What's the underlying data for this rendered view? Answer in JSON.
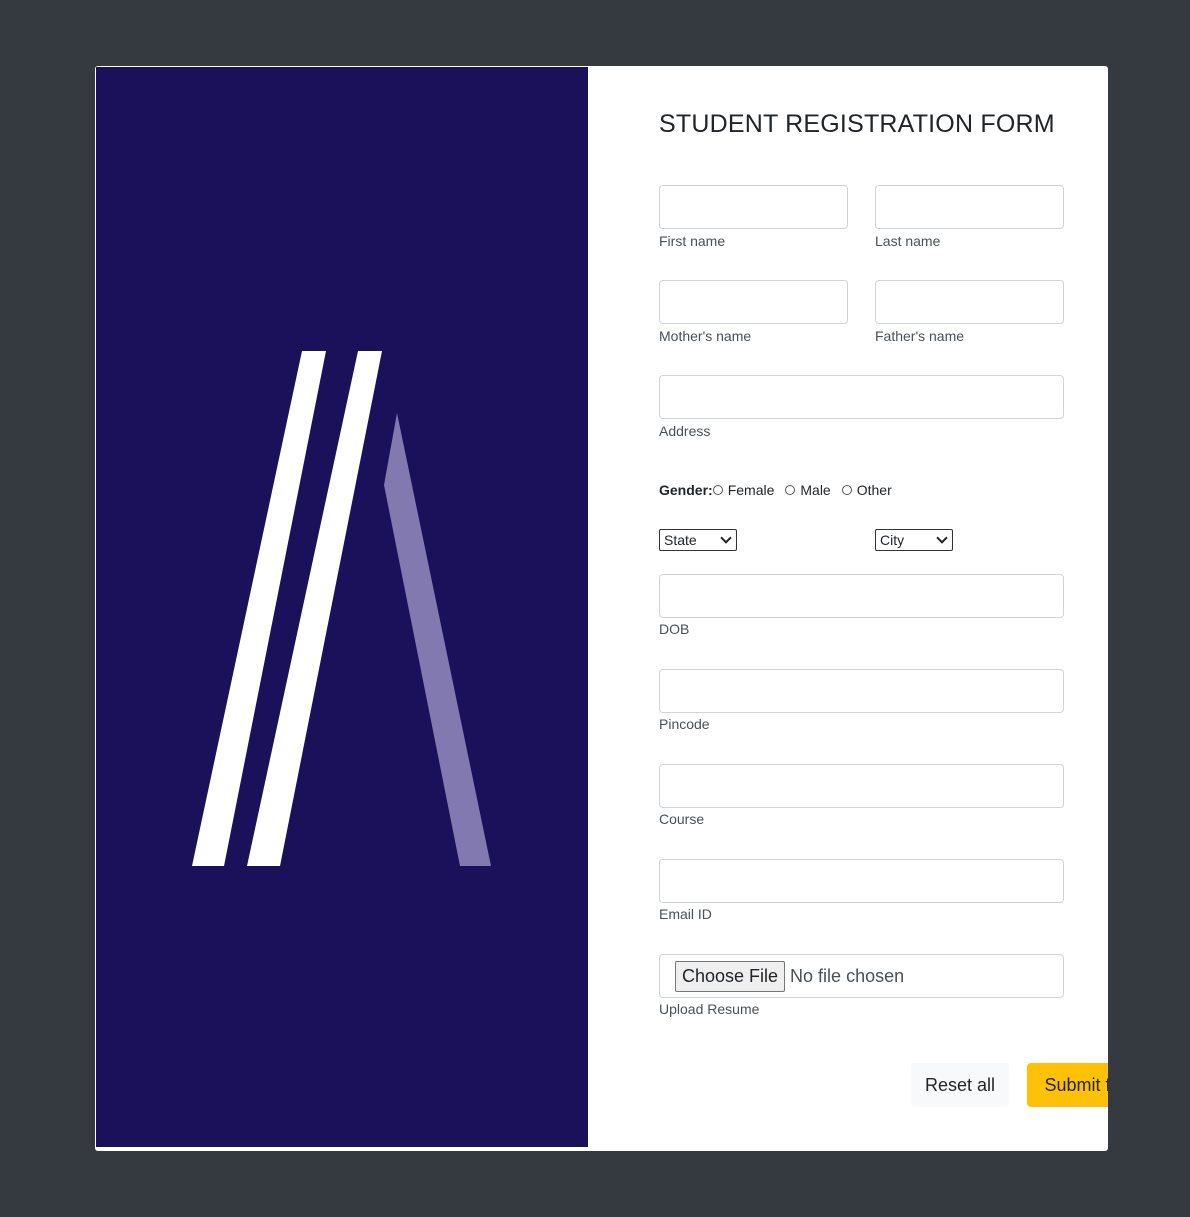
{
  "colors": {
    "page_background": "#343a40",
    "brand_panel": "#1a115a",
    "logo_bars": "#ffffff",
    "logo_accent": "#8279b0",
    "submit_button": "#ffc107",
    "reset_button": "#f8f9fa"
  },
  "form": {
    "title": "STUDENT REGISTRATION FORM",
    "fields": {
      "first_name": {
        "label": "First name",
        "value": ""
      },
      "last_name": {
        "label": "Last name",
        "value": ""
      },
      "mothers_name": {
        "label": "Mother's name",
        "value": ""
      },
      "fathers_name": {
        "label": "Father's name",
        "value": ""
      },
      "address": {
        "label": "Address",
        "value": ""
      },
      "dob": {
        "label": "DOB",
        "value": ""
      },
      "pincode": {
        "label": "Pincode",
        "value": ""
      },
      "course": {
        "label": "Course",
        "value": ""
      },
      "email": {
        "label": "Email ID",
        "value": ""
      }
    },
    "gender": {
      "label": "Gender:",
      "options": [
        "Female",
        "Male",
        "Other"
      ]
    },
    "state_select": {
      "selected": "State",
      "icon": "chevron-down-icon"
    },
    "city_select": {
      "selected": "City",
      "icon": "chevron-down-icon"
    },
    "resume": {
      "label": "Upload Resume",
      "button_label": "Choose File",
      "status": "No file chosen"
    },
    "buttons": {
      "reset_label": "Reset all",
      "submit_label": "Submit form"
    }
  }
}
